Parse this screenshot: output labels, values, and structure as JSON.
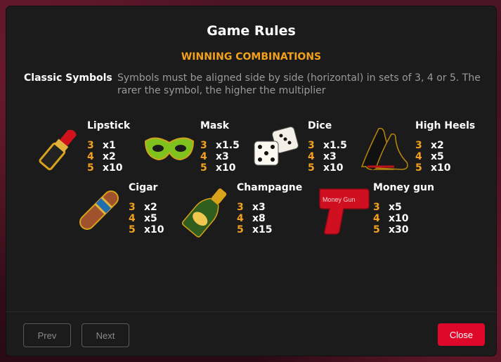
{
  "modal": {
    "title": "Game Rules",
    "section_title": "WINNING COMBINATIONS",
    "classic_label": "Classic Symbols",
    "classic_description": "Symbols must be aligned side by side (horizontal) in sets of 3, 4 or 5. The rarer the symbol, the higher the multiplier"
  },
  "symbols": [
    {
      "name": "Lipstick",
      "icon": "lipstick-icon",
      "pays": [
        {
          "count": "3",
          "mult": "x1"
        },
        {
          "count": "4",
          "mult": "x2"
        },
        {
          "count": "5",
          "mult": "x10"
        }
      ]
    },
    {
      "name": "Mask",
      "icon": "mask-icon",
      "pays": [
        {
          "count": "3",
          "mult": "x1.5"
        },
        {
          "count": "4",
          "mult": "x3"
        },
        {
          "count": "5",
          "mult": "x10"
        }
      ]
    },
    {
      "name": "Dice",
      "icon": "dice-icon",
      "pays": [
        {
          "count": "3",
          "mult": "x1.5"
        },
        {
          "count": "4",
          "mult": "x3"
        },
        {
          "count": "5",
          "mult": "x10"
        }
      ]
    },
    {
      "name": "High Heels",
      "icon": "high-heels-icon",
      "pays": [
        {
          "count": "3",
          "mult": "x2"
        },
        {
          "count": "4",
          "mult": "x5"
        },
        {
          "count": "5",
          "mult": "x10"
        }
      ]
    },
    {
      "name": "Cigar",
      "icon": "cigar-icon",
      "pays": [
        {
          "count": "3",
          "mult": "x2"
        },
        {
          "count": "4",
          "mult": "x5"
        },
        {
          "count": "5",
          "mult": "x10"
        }
      ]
    },
    {
      "name": "Champagne",
      "icon": "champagne-icon",
      "pays": [
        {
          "count": "3",
          "mult": "x3"
        },
        {
          "count": "4",
          "mult": "x8"
        },
        {
          "count": "5",
          "mult": "x15"
        }
      ]
    },
    {
      "name": "Money gun",
      "icon": "money-gun-icon",
      "icon_text": "Money Gun",
      "pays": [
        {
          "count": "3",
          "mult": "x5"
        },
        {
          "count": "4",
          "mult": "x10"
        },
        {
          "count": "5",
          "mult": "x30"
        }
      ]
    }
  ],
  "footer": {
    "prev_label": "Prev",
    "next_label": "Next",
    "close_label": "Close"
  },
  "colors": {
    "accent": "#f2a01d",
    "close_button": "#e0082a",
    "modal_bg": "#1b1b1b"
  }
}
